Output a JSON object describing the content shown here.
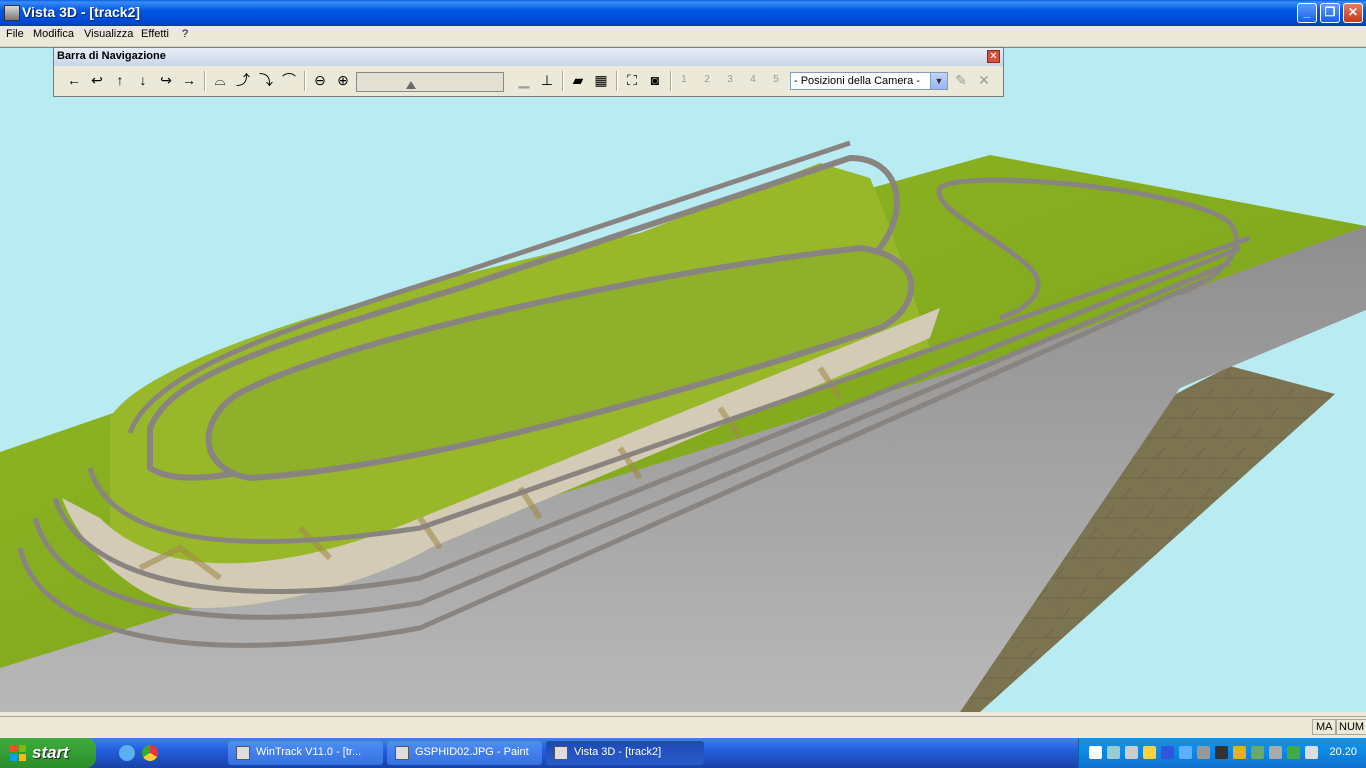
{
  "window": {
    "title": "Vista 3D - [track2]",
    "min": "_",
    "restore": "❐",
    "close": "✕"
  },
  "menu": [
    "File",
    "Modifica",
    "Visualizza",
    "Effetti",
    "?"
  ],
  "nav": {
    "title": "Barra di Navigazione",
    "close": "✕",
    "buttons": [
      "←",
      "↩",
      "↑",
      "↓",
      "↪",
      "→"
    ],
    "camera_select": "- Posizioni della Camera -",
    "camera_slots": [
      "1",
      "2",
      "3",
      "4",
      "5"
    ]
  },
  "status": {
    "caps": "MA",
    "num": "NUM"
  },
  "taskbar": {
    "start": "start",
    "tasks": [
      {
        "label": "WinTrack  V11.0 - [tr...",
        "active": false
      },
      {
        "label": "GSPHID02.JPG - Paint",
        "active": false
      },
      {
        "label": "Vista 3D - [track2]",
        "active": true
      }
    ],
    "clock": "20.20"
  },
  "colors": {
    "sky": "#b8ecf2",
    "grass": "#86ab22",
    "track": "#8a8480",
    "cliff": "#d4cbb6",
    "floor": "#7c7350",
    "titlebar": "#0058e6"
  }
}
